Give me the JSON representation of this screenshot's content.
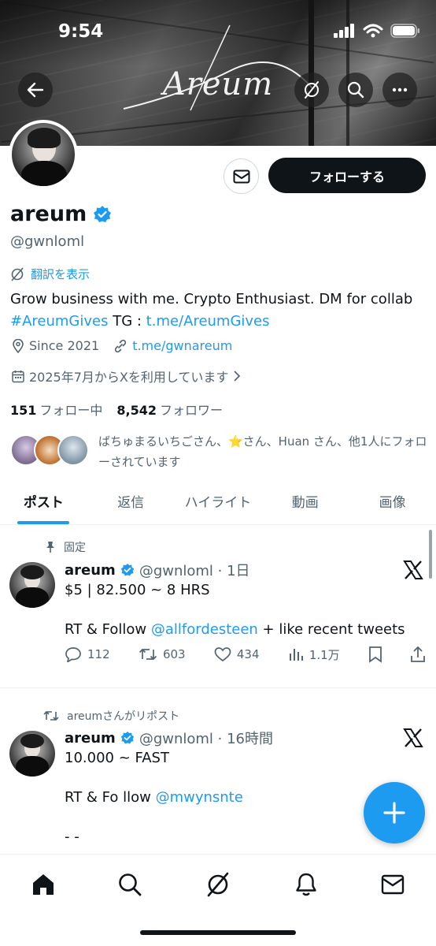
{
  "status_bar": {
    "time": "9:54"
  },
  "banner": {
    "logo_text": "Areum"
  },
  "profile": {
    "follow_label": "フォローする",
    "display_name": "areum",
    "handle": "@gwnloml",
    "translate_label": "翻訳を表示",
    "bio_line1": "Grow business with me. Crypto Enthusiast. DM for collab",
    "bio_hashtag": "#AreumGives",
    "bio_tg_prefix": " TG : ",
    "bio_link": "t.me/AreumGives",
    "location": "Since 2021",
    "website": "t.me/gwnareum",
    "joined": "2025年7月からXを利用しています",
    "following_count": "151",
    "following_label": "フォロー中",
    "followers_count": "8,542",
    "followers_label": "フォロワー",
    "known_followers_text": "ばちゅまるいちごさん、⭐さん、Huan さん、他1人にフォローされています"
  },
  "tabs": [
    {
      "label": "ポスト",
      "active": true
    },
    {
      "label": "返信"
    },
    {
      "label": "ハイライト"
    },
    {
      "label": "動画"
    },
    {
      "label": "画像"
    }
  ],
  "posts": [
    {
      "context": "固定",
      "name": "areum",
      "handle_time": "@gwnloml · 1日",
      "line1": "$5 | 82.500 ~ 8 HRS",
      "line2_prefix": "RT & Follow ",
      "line2_mention": "@allfordesteen",
      "line2_suffix": " + like recent tweets",
      "replies": "112",
      "reposts": "603",
      "likes": "434",
      "views": "1.1万"
    },
    {
      "context": "areumさんがリポスト",
      "name": "areum",
      "handle_time": "@gwnloml · 16時間",
      "line1": "10.000 ~ FAST",
      "line2_prefix": "RT & Fo llow ",
      "line2_mention": "@mwynsnte",
      "line3": "- -"
    }
  ],
  "colors": {
    "accent": "#1d9bf0",
    "text": "#0f1419",
    "muted": "#536471"
  }
}
